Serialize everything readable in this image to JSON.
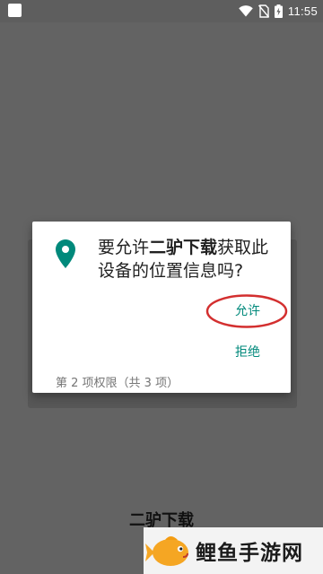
{
  "status_bar": {
    "time": "11:55",
    "icons": [
      "app-icon",
      "wifi-icon",
      "no-sim-icon",
      "battery-charging-icon"
    ]
  },
  "background_app": {
    "title": "二驴下载"
  },
  "dialog": {
    "message_prefix": "要允许",
    "app_name": "二驴下载",
    "message_suffix": "获取此设备的位置信息吗?",
    "icon": "location-pin-icon",
    "allow_label": "允许",
    "deny_label": "拒绝",
    "permission_counter": "第 2 项权限（共 3 项）"
  },
  "watermark": {
    "text": "鲤鱼手游网",
    "icon": "fish-logo-icon"
  },
  "colors": {
    "accent": "#00897b",
    "highlight": "#d32f2f",
    "scrim": "#636363",
    "status_bar": "#5e5e5e"
  }
}
